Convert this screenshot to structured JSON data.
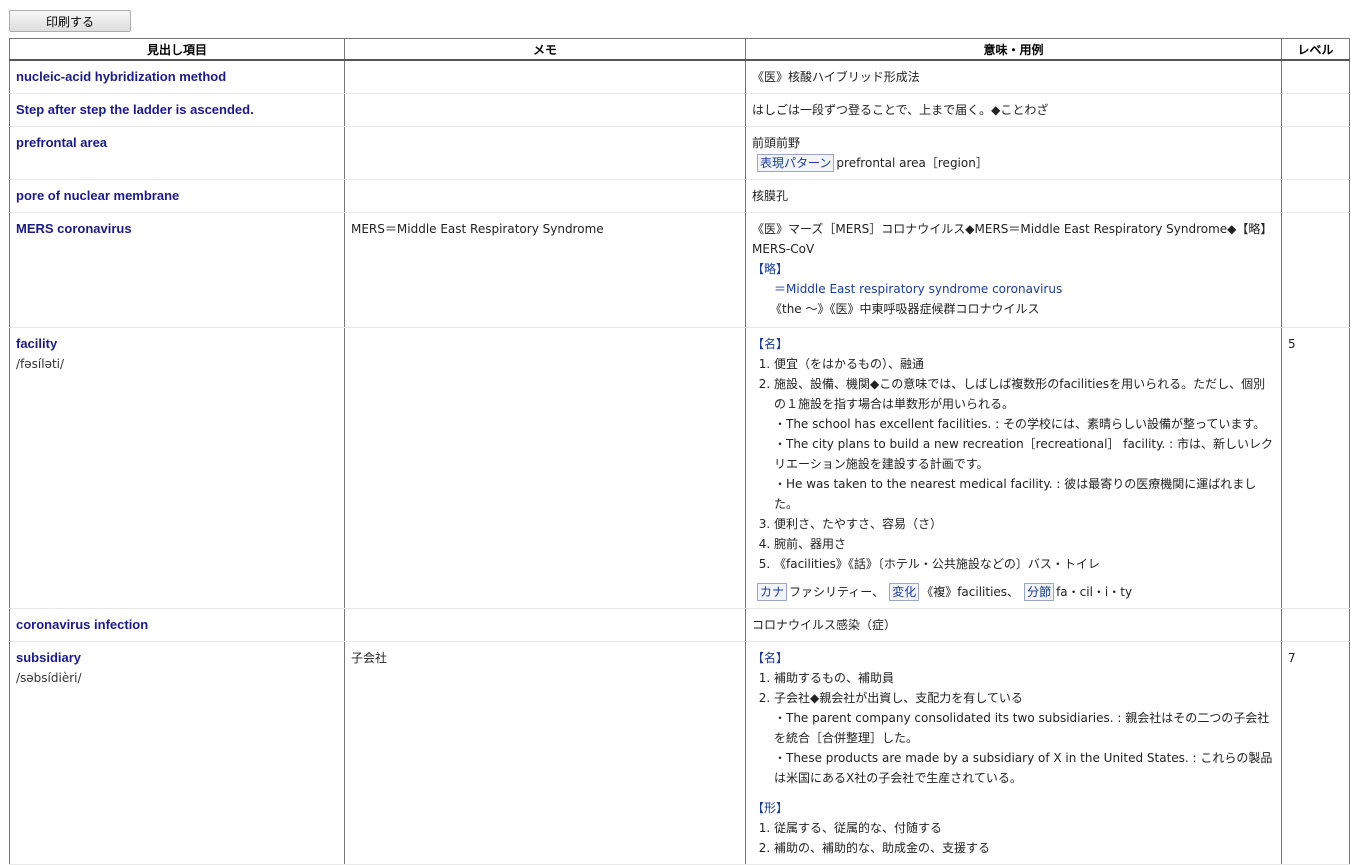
{
  "print_button": "印刷する",
  "columns": {
    "headword": "見出し項目",
    "memo": "メモ",
    "meaning": "意味・用例",
    "level": "レベル"
  },
  "rows": [
    {
      "headword": "nucleic-acid hybridization method",
      "memo": "",
      "level": "",
      "meaning": [
        "《医》核酸ハイブリッド形成法"
      ]
    },
    {
      "headword": "Step after step the ladder is ascended.",
      "memo": "",
      "level": "",
      "meaning": [
        "はしごは一段ずつ登ることで、上まで届く。◆ことわざ"
      ]
    },
    {
      "headword": "prefrontal area",
      "memo": "",
      "level": "",
      "meaning": [
        "前頭前野"
      ],
      "tag": {
        "label": "表現パターン",
        "text": "prefrontal area［region］"
      }
    },
    {
      "headword": "pore of nuclear membrane",
      "memo": "",
      "level": "",
      "meaning": [
        "核膜孔"
      ]
    },
    {
      "headword": "MERS coronavirus",
      "memo": "MERS＝Middle East Respiratory Syndrome",
      "level": "",
      "meaning": [
        "《医》マーズ［MERS］コロナウイルス◆MERS＝Middle East Respiratory Syndrome◆【略】MERS-CoV"
      ],
      "abbr_label": "【略】",
      "abbr_value": "＝Middle East respiratory syndrome coronavirus",
      "abbr_gloss": "《the ～》《医》中東呼吸器症候群コロナウイルス"
    },
    {
      "headword": "facility",
      "pron": "/fəsíləti/",
      "memo": "",
      "level": "5",
      "pos": "【名】",
      "senses": [
        "便宜（をはかるもの）、融通",
        "施設、設備、機関◆この意味では、しばしば複数形のfacilitiesを用いられる。ただし、個別の１施設を指す場合は単数形が用いられる。",
        "便利さ、たやすさ、容易（さ）",
        "腕前、器用さ",
        "《facilities》《話》〔ホテル・公共施設などの〕バス・トイレ"
      ],
      "examples": [
        "・The school has excellent facilities. : その学校には、素晴らしい設備が整っています。",
        "・The city plans to build a new recreation［recreational］ facility. : 市は、新しいレクリエーション施設を建設する計画です。",
        "・He was taken to the nearest medical facility. : 彼は最寄りの医療機関に運ばれました。"
      ],
      "tags": [
        {
          "label": "カナ",
          "text": "ファシリティー、"
        },
        {
          "label": "変化",
          "text": "《複》facilities、"
        },
        {
          "label": "分節",
          "text": "fa・cil・i・ty"
        }
      ]
    },
    {
      "headword": "coronavirus infection",
      "memo": "",
      "level": "",
      "meaning": [
        "コロナウイルス感染（症）"
      ]
    },
    {
      "headword": "subsidiary",
      "pron": "/səbsídièri/",
      "memo": "子会社",
      "level": "7",
      "pos": "【名】",
      "senses": [
        "補助するもの、補助員",
        "子会社◆親会社が出資し、支配力を有している"
      ],
      "examples": [
        "・The parent company consolidated its two subsidiaries. : 親会社はその二つの子会社を統合［合併整理］した。",
        "・These products are made by a subsidiary of X in the United States. : これらの製品は米国にあるX社の子会社で生産されている。"
      ],
      "pos2": "【形】",
      "senses2": [
        "従属する、従属的な、付随する",
        "補助の、補助的な、助成金の、支援する"
      ]
    }
  ]
}
